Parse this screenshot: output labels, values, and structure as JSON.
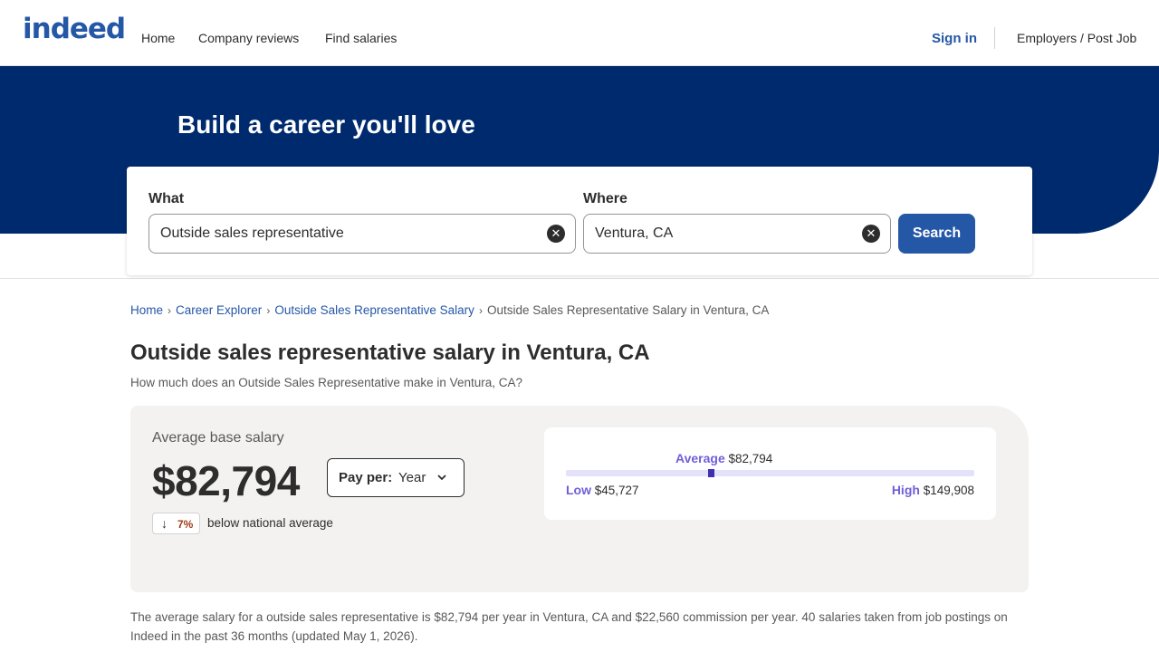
{
  "header": {
    "logo": "indeed",
    "nav": [
      "Home",
      "Company reviews",
      "Find salaries"
    ],
    "sign_in": "Sign in",
    "employers": "Employers / Post Job"
  },
  "hero": {
    "title": "Build a career you'll love"
  },
  "search": {
    "what_label": "What",
    "what_value": "Outside sales representative",
    "where_label": "Where",
    "where_value": "Ventura, CA",
    "button": "Search"
  },
  "breadcrumb": {
    "items": [
      "Home",
      "Career Explorer",
      "Outside Sales Representative Salary"
    ],
    "current": "Outside Sales Representative Salary in Ventura, CA"
  },
  "page": {
    "title": "Outside sales representative salary in Ventura, CA",
    "subtitle": "How much does an Outside Sales Representative make in Ventura, CA?"
  },
  "salary": {
    "avg_label": "Average base salary",
    "avg_value": "$82,794",
    "pay_per_label": "Pay per:",
    "pay_per_value": "Year",
    "trend_pct": "7%",
    "trend_text": "below national average",
    "range": {
      "average_label": "Average",
      "average_value": "$82,794",
      "low_label": "Low",
      "low_value": "$45,727",
      "high_label": "High",
      "high_value": "$149,908",
      "low_num": 45727,
      "high_num": 149908,
      "avg_num": 82794
    }
  },
  "summary": "The average salary for a outside sales representative is $82,794 per year in Ventura, CA and $22,560 commission per year. 40 salaries taken from job postings on Indeed in the past 36 months (updated May 1, 2026).",
  "colors": {
    "brand_blue": "#2557a7",
    "hero_navy": "#002a6e",
    "range_purple": "#6f5fd8"
  }
}
